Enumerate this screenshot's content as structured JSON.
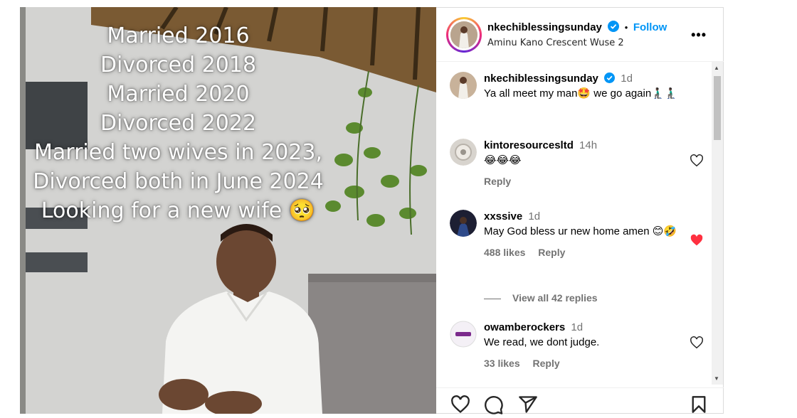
{
  "post": {
    "overlay_lines": [
      "Married 2016",
      "Divorced 2018",
      "Married 2020",
      "Divorced 2022",
      "Married two wives in 2023,",
      "Divorced both in June 2024",
      "Looking for a new wife 🥺"
    ]
  },
  "header": {
    "username": "nkechiblessingsunday",
    "follow_label": "Follow",
    "separator": "•",
    "location": "Aminu Kano Crescent Wuse 2",
    "more_icon": "more-horizontal-icon"
  },
  "comments": [
    {
      "username": "nkechiblessingsunday",
      "time": "1d",
      "text": "Ya all meet my man🤩 we go again🧎🏿‍♂️🧎🏿‍♂️",
      "avatar_color": "#c8b29a"
    },
    {
      "username": "kintoresourcesltd",
      "time": "14h",
      "text": "😂😂😂",
      "reply_label": "Reply",
      "liked": false,
      "avatar_color": "#d8d4ce"
    },
    {
      "username": "xxssive",
      "time": "1d",
      "text": "May God bless ur new home amen 😊🤣",
      "likes": "488 likes",
      "reply_label": "Reply",
      "liked": true,
      "view_replies": "View all 42 replies",
      "avatar_color": "#1d1f33"
    },
    {
      "username": "owamberockers",
      "time": "1d",
      "text": "We read, we dont judge.",
      "likes": "33 likes",
      "reply_label": "Reply",
      "liked": false,
      "avatar_color": "#f4f0f6"
    }
  ],
  "colors": {
    "accent": "#0095f6",
    "liked_heart": "#ff3040",
    "muted_text": "#737373"
  },
  "actions": [
    "heart-icon",
    "comment-icon",
    "share-icon",
    "bookmark-icon"
  ]
}
